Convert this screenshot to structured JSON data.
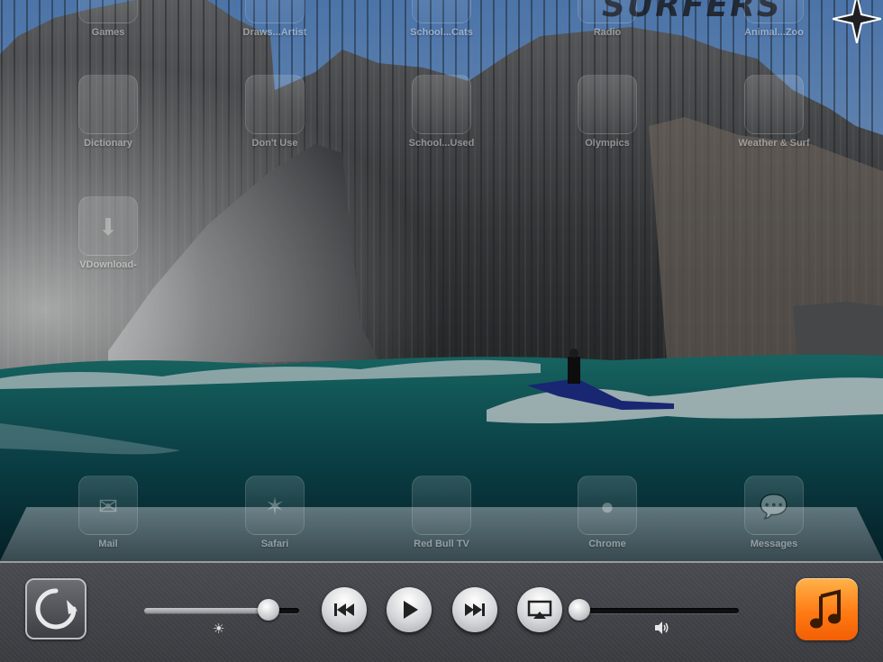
{
  "home_screen": {
    "top_row": [
      {
        "label": "Games",
        "icon": "folder-icon"
      },
      {
        "label": "Draws...Artist",
        "icon": "folder-icon"
      },
      {
        "label": "School...Cats",
        "icon": "folder-icon"
      },
      {
        "label": "Radio",
        "icon": "radio-icon"
      },
      {
        "label": "Animal...Zoo",
        "icon": "folder-icon"
      }
    ],
    "row1": [
      {
        "label": "Dictionary",
        "icon": "folder-icon"
      },
      {
        "label": "Don't Use",
        "icon": "folder-icon"
      },
      {
        "label": "School...Used",
        "icon": "folder-icon"
      },
      {
        "label": "Olympics",
        "icon": "olympics-icon"
      },
      {
        "label": "Weather & Surf",
        "icon": "folder-icon"
      }
    ],
    "row2": [
      {
        "label": "VDownload-",
        "icon": "download-icon"
      }
    ],
    "dock": [
      {
        "label": "Mail",
        "icon": "mail-icon"
      },
      {
        "label": "Safari",
        "icon": "safari-icon"
      },
      {
        "label": "Red Bull TV",
        "icon": "redbull-icon"
      },
      {
        "label": "Chrome",
        "icon": "chrome-icon"
      },
      {
        "label": "Messages",
        "icon": "messages-icon"
      }
    ],
    "brand_text": "SURFERS"
  },
  "control_bar": {
    "brightness_level": 0.8,
    "volume_level": 0.0,
    "buttons": [
      "rotation-lock",
      "previous",
      "play",
      "next",
      "airplay",
      "music"
    ]
  },
  "colors": {
    "bar_background": "#3f4045",
    "music_icon_orange": "#ff7a14",
    "sky": "#6f9fd6",
    "sea": "#0f5a5c"
  }
}
